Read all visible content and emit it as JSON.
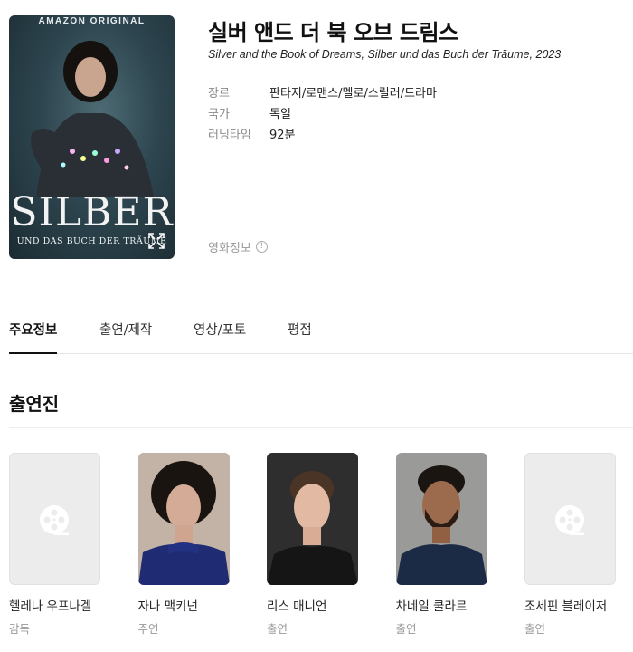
{
  "poster": {
    "brand": "AMAZON ORIGINAL",
    "title_big": "SILBER",
    "title_sub": "UND DAS BUCH DER TRÄUME",
    "expand_icon": "expand-icon"
  },
  "movie": {
    "title": "실버 앤드 더 북 오브 드림스",
    "original": "Silver and the Book of Dreams, Silber und das Buch der Träume, 2023",
    "info": [
      {
        "key": "장르",
        "value": "판타지/로맨스/멜로/스릴러/드라마"
      },
      {
        "key": "국가",
        "value": "독일"
      },
      {
        "key": "러닝타임",
        "value": "92분"
      }
    ],
    "movie_info_label": "영화정보",
    "movie_info_icon": "info-icon"
  },
  "tabs": [
    {
      "label": "주요정보",
      "active": true
    },
    {
      "label": "출연/제작",
      "active": false
    },
    {
      "label": "영상/포토",
      "active": false
    },
    {
      "label": "평점",
      "active": false
    }
  ],
  "cast_section": {
    "title": "출연진",
    "people": [
      {
        "name": "헬레나 우프나겔",
        "role": "감독",
        "photo": "placeholder"
      },
      {
        "name": "자나 맥키넌",
        "role": "주연",
        "photo": "woman"
      },
      {
        "name": "리스 매니언",
        "role": "출연",
        "photo": "man-light"
      },
      {
        "name": "차네일 쿨라르",
        "role": "출연",
        "photo": "man-beard"
      },
      {
        "name": "조세핀 블레이저",
        "role": "출연",
        "photo": "placeholder"
      }
    ]
  },
  "colors": {
    "accent": "#111111",
    "muted": "#999999",
    "placeholder_bg": "#ececec"
  }
}
